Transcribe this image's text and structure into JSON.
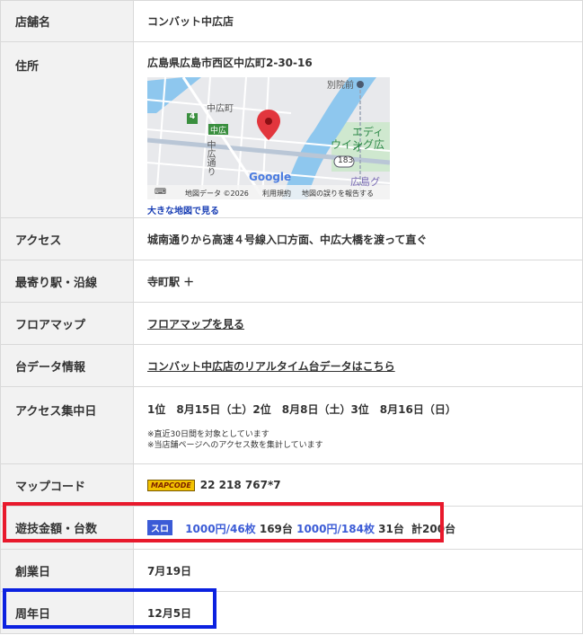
{
  "rows": {
    "shop_name": {
      "label": "店舗名",
      "value": "コンバット中広店"
    },
    "address": {
      "label": "住所",
      "value": "広島県広島市西区中広町2-30-16",
      "big_map_link": "大きな地図で見る",
      "map": {
        "labels": {
          "betsuin": "別院前",
          "nakahiro_cho": "中広町",
          "route4": "4",
          "nakahiro_sign": "中広",
          "edion": "エディオ",
          "wing": "ウイング広",
          "nakahiro_dori": "中広通り",
          "route183": "183",
          "hiroshima_g": "広島グ",
          "google": "Google",
          "attribution": "地図データ ©2026",
          "terms": "利用規約",
          "report": "地図の誤りを報告する"
        }
      }
    },
    "access": {
      "label": "アクセス",
      "value": "城南通りから高速４号線入口方面、中広大橋を渡って直ぐ"
    },
    "station": {
      "label": "最寄り駅・沿線",
      "value": "寺町駅 ＋"
    },
    "floor_map": {
      "label": "フロアマップ",
      "value": "フロアマップを見る"
    },
    "machine_data": {
      "label": "台データ情報",
      "value": "コンバット中広店のリアルタイム台データはこちら"
    },
    "access_peak": {
      "label": "アクセス集中日",
      "value": "1位　8月15日（土）2位　8月8日（土）3位　8月16日（日）",
      "note1": "※直近30日間を対象としています",
      "note2": "※当店舗ページへのアクセス数を集計しています"
    },
    "map_code": {
      "label": "マップコード",
      "logo": "MAPCODE",
      "value": "22 218 767*7"
    },
    "rates": {
      "label": "遊技金額・台数",
      "badge": "スロ",
      "rate1": "1000円/46枚",
      "count1": "169台",
      "rate2": "1000円/184枚",
      "count2": "31台",
      "total": "計200台"
    },
    "founded": {
      "label": "創業日",
      "value": "7月19日"
    },
    "anniversary": {
      "label": "周年日",
      "value": "12月5日"
    }
  },
  "colors": {
    "highlight_red": "#e8192c",
    "highlight_blue": "#0b21e0",
    "link_blue": "#3b5bd6"
  }
}
